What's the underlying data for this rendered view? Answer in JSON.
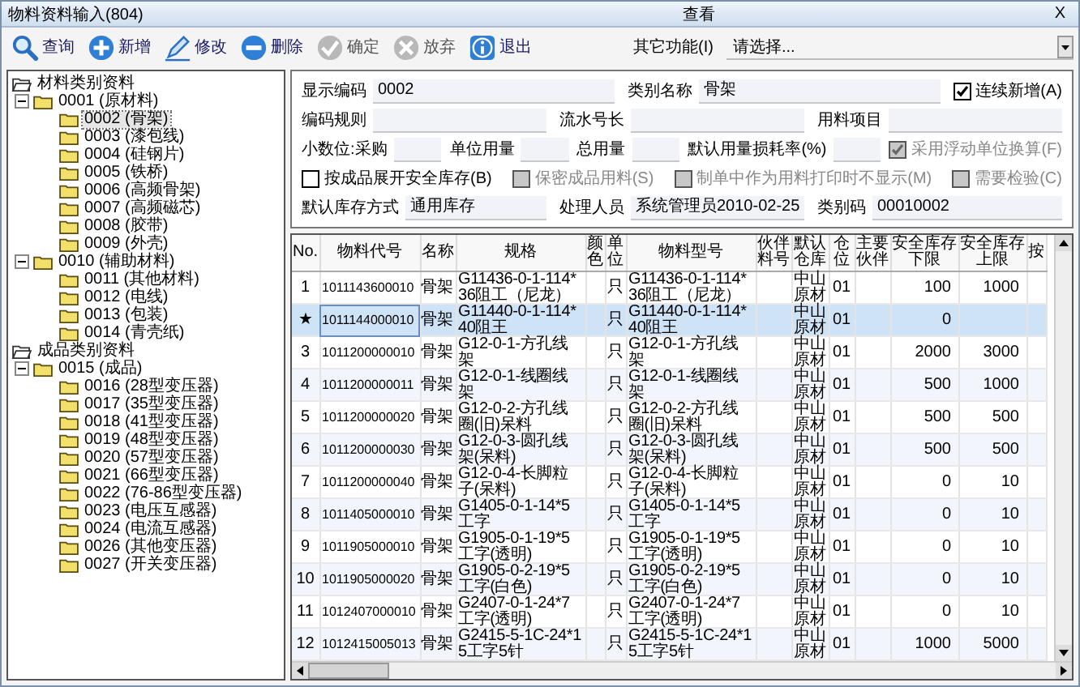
{
  "window": {
    "title": "物料资料输入(804)",
    "mode": "查看",
    "close": "X"
  },
  "toolbar": {
    "buttons": [
      {
        "kind": "search",
        "label": "查询",
        "disabled": false
      },
      {
        "kind": "add",
        "label": "新增",
        "disabled": false
      },
      {
        "kind": "edit",
        "label": "修改",
        "disabled": false
      },
      {
        "kind": "delete",
        "label": "删除",
        "disabled": false
      },
      {
        "kind": "confirm",
        "label": "确定",
        "disabled": true
      },
      {
        "kind": "cancel",
        "label": "放弃",
        "disabled": true
      },
      {
        "kind": "exit",
        "label": "退出",
        "disabled": false
      }
    ],
    "other_label": "其它功能(I)",
    "other_value": "请选择..."
  },
  "tree": [
    {
      "label": "材料类别资料",
      "kind": "root",
      "expanded": true,
      "selected": false,
      "children": [
        {
          "label": "0001 (原材料)",
          "expanded": true,
          "selected": false,
          "children": [
            {
              "label": "0002 (骨架)",
              "selected": true
            },
            {
              "label": "0003 (漆包线)",
              "selected": false
            },
            {
              "label": "0004 (硅钢片)",
              "selected": false
            },
            {
              "label": "0005 (铁桥)",
              "selected": false
            },
            {
              "label": "0006 (高频骨架)",
              "selected": false
            },
            {
              "label": "0007 (高频磁芯)",
              "selected": false
            },
            {
              "label": "0008 (胶带)",
              "selected": false
            },
            {
              "label": "0009 (外壳)",
              "selected": false
            }
          ]
        },
        {
          "label": "0010 (辅助材料)",
          "expanded": true,
          "selected": false,
          "children": [
            {
              "label": "0011 (其他材料)",
              "selected": false
            },
            {
              "label": "0012 (电线)",
              "selected": false
            },
            {
              "label": "0013 (包装)",
              "selected": false
            },
            {
              "label": "0014 (青壳纸)",
              "selected": false
            }
          ]
        }
      ]
    },
    {
      "label": "成品类别资料",
      "kind": "root",
      "expanded": true,
      "selected": false,
      "children": [
        {
          "label": "0015 (成品)",
          "expanded": true,
          "selected": false,
          "children": [
            {
              "label": "0016 (28型变压器)",
              "selected": false
            },
            {
              "label": "0017 (35型变压器)",
              "selected": false
            },
            {
              "label": "0018 (41型变压器)",
              "selected": false
            },
            {
              "label": "0019 (48型变压器)",
              "selected": false
            },
            {
              "label": "0020 (57型变压器)",
              "selected": false
            },
            {
              "label": "0021 (66型变压器)",
              "selected": false
            },
            {
              "label": "0022 (76-86型变压器)",
              "selected": false
            },
            {
              "label": "0023 (电压互感器)",
              "selected": false
            },
            {
              "label": "0024 (电流互感器)",
              "selected": false
            },
            {
              "label": "0026 (其他变压器)",
              "selected": false
            },
            {
              "label": "0027 (开关变压器)",
              "selected": false
            }
          ]
        }
      ]
    }
  ],
  "form": {
    "display_code": {
      "kind": "field",
      "label": "显示编码",
      "value": "0002"
    },
    "category_name": {
      "kind": "field",
      "label": "类别名称",
      "value": "骨架"
    },
    "continuous_add": {
      "kind": "checkbox",
      "label": "连续新增(A)",
      "checked": true,
      "disabled": false
    },
    "code_rule": {
      "kind": "field",
      "label": "编码规则"
    },
    "serial_length": {
      "kind": "field",
      "label": "流水号长"
    },
    "material_item": {
      "kind": "field",
      "label": "用料项目"
    },
    "decimals_purchase": {
      "kind": "field",
      "label": "小数位:采购"
    },
    "unit_usage": {
      "kind": "field",
      "label": "单位用量"
    },
    "total_usage": {
      "kind": "field",
      "label": "总用量"
    },
    "loss_rate": {
      "kind": "field",
      "label": "默认用量损耗率(%)"
    },
    "floating_unit": {
      "kind": "checkbox",
      "label": "采用浮动单位换算(F)",
      "checked": true,
      "disabled": true
    },
    "expand_safety_stock": {
      "kind": "checkbox",
      "label": "按成品展开安全库存(B)",
      "checked": false,
      "disabled": false
    },
    "confidential": {
      "kind": "checkbox",
      "label": "保密成品用料(S)",
      "checked": false,
      "disabled": true
    },
    "hide_on_print": {
      "kind": "checkbox",
      "label": "制单中作为用料打印时不显示(M)",
      "checked": false,
      "disabled": true
    },
    "inspection": {
      "kind": "checkbox",
      "label": "需要检验(C)",
      "checked": false,
      "disabled": true
    },
    "default_stock_mode": {
      "kind": "field",
      "label": "默认库存方式",
      "value": "通用库存"
    },
    "handler": {
      "kind": "field",
      "label": "处理人员",
      "value": "系统管理员2010-02-25"
    },
    "category_code": {
      "kind": "field",
      "label": "类别码",
      "value": "00010002"
    }
  },
  "table": {
    "columns": [
      "No.",
      "物料代号",
      "名称",
      "规格",
      "颜色",
      "单位",
      "物料型号",
      "伙伴料号",
      "默认仓库",
      "仓位",
      "主要伙伴",
      "安全库存下限",
      "安全库存上限",
      "按"
    ],
    "rows": [
      {
        "no": "1",
        "code": "1011143600010",
        "name": "骨架",
        "spec": "G11436-0-1-114*36阻工（尼龙）",
        "unit": "只",
        "model": "G11436-0-1-114*36阻工（尼龙）",
        "warehouse": "中山原材",
        "bin": "01",
        "low": "100",
        "high": "1000",
        "selected": false
      },
      {
        "no": "★",
        "code": "1011144000010",
        "name": "骨架",
        "spec": "G11440-0-1-114*40阻王",
        "unit": "只",
        "model": "G11440-0-1-114*40阻王",
        "warehouse": "中山原材",
        "bin": "01",
        "low": "0",
        "selected": true
      },
      {
        "no": "3",
        "code": "1011200000010",
        "name": "骨架",
        "spec": "G12-0-1-方孔线架",
        "unit": "只",
        "model": "G12-0-1-方孔线架",
        "warehouse": "中山原材",
        "bin": "01",
        "low": "2000",
        "high": "3000",
        "selected": false
      },
      {
        "no": "4",
        "code": "1011200000011",
        "name": "骨架",
        "spec": "G12-0-1-线圈线架",
        "unit": "只",
        "model": "G12-0-1-线圈线架",
        "warehouse": "中山原材",
        "bin": "01",
        "low": "500",
        "high": "1000",
        "selected": false
      },
      {
        "no": "5",
        "code": "1011200000020",
        "name": "骨架",
        "spec": "G12-0-2-方孔线圈(旧)呆料",
        "unit": "只",
        "model": "G12-0-2-方孔线圈(旧)呆料",
        "warehouse": "中山原材",
        "bin": "01",
        "low": "500",
        "high": "500",
        "selected": false
      },
      {
        "no": "6",
        "code": "1011200000030",
        "name": "骨架",
        "spec": "G12-0-3-圆孔线架(呆料)",
        "unit": "只",
        "model": "G12-0-3-圆孔线架(呆料)",
        "warehouse": "中山原材",
        "bin": "01",
        "low": "500",
        "high": "500",
        "selected": false
      },
      {
        "no": "7",
        "code": "1011200000040",
        "name": "骨架",
        "spec": "G12-0-4-长脚粒子(呆料)",
        "unit": "只",
        "model": "G12-0-4-长脚粒子(呆料)",
        "warehouse": "中山原材",
        "bin": "01",
        "low": "0",
        "high": "10",
        "selected": false
      },
      {
        "no": "8",
        "code": "1011405000010",
        "name": "骨架",
        "spec": "G1405-0-1-14*5工字",
        "unit": "只",
        "model": "G1405-0-1-14*5工字",
        "warehouse": "中山原材",
        "bin": "01",
        "low": "0",
        "high": "10",
        "selected": false
      },
      {
        "no": "9",
        "code": "1011905000010",
        "name": "骨架",
        "spec": "G1905-0-1-19*5工字(透明)",
        "unit": "只",
        "model": "G1905-0-1-19*5工字(透明)",
        "warehouse": "中山原材",
        "bin": "01",
        "low": "0",
        "high": "10",
        "selected": false
      },
      {
        "no": "10",
        "code": "1011905000020",
        "name": "骨架",
        "spec": "G1905-0-2-19*5工字(白色)",
        "unit": "只",
        "model": "G1905-0-2-19*5工字(白色)",
        "warehouse": "中山原材",
        "bin": "01",
        "low": "0",
        "high": "10",
        "selected": false
      },
      {
        "no": "11",
        "code": "1012407000010",
        "name": "骨架",
        "spec": "G2407-0-1-24*7工字(透明)",
        "unit": "只",
        "model": "G2407-0-1-24*7工字(透明)",
        "warehouse": "中山原材",
        "bin": "01",
        "low": "0",
        "high": "10",
        "selected": false
      },
      {
        "no": "12",
        "code": "1012415005013",
        "name": "骨架",
        "spec": "G2415-5-1C-24*15工字5针",
        "unit": "只",
        "model": "G2415-5-1C-24*15工字5针",
        "warehouse": "中山原材",
        "bin": "01",
        "low": "1000",
        "high": "5000",
        "selected": false
      }
    ]
  }
}
